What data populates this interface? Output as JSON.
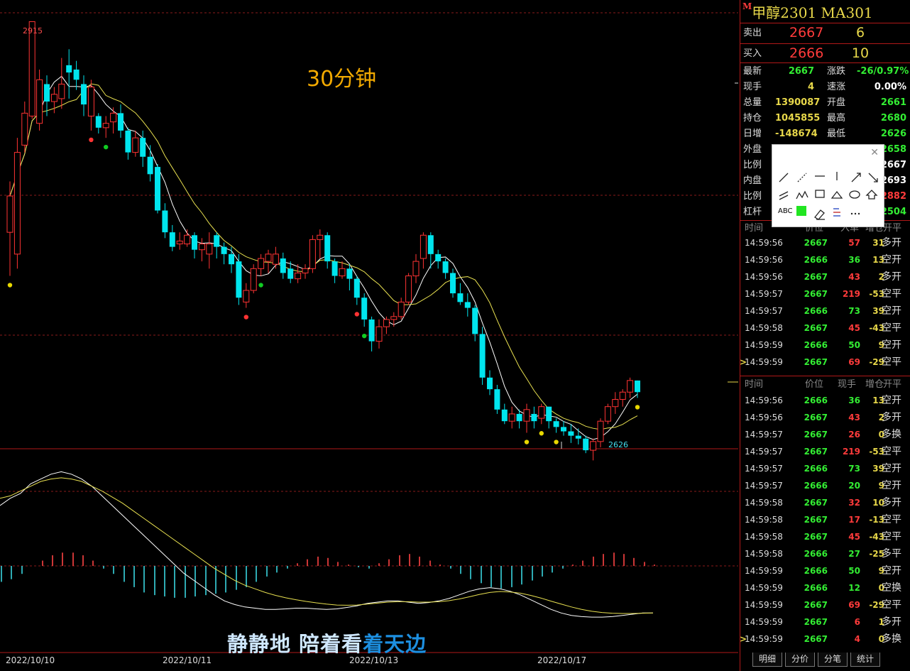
{
  "chart_data": {
    "type": "candlestick",
    "period_label": "30分钟",
    "max_label": "2915",
    "min_label": "2626",
    "ylim": [
      2622,
      2925
    ],
    "dates": [
      "2022/10/10",
      "2022/10/11",
      "2022/10/13",
      "2022/10/17"
    ],
    "candles": [
      [
        2770,
        2795,
        2740,
        2805
      ],
      [
        2755,
        2825,
        2745,
        2835
      ],
      [
        2830,
        2852,
        2825,
        2860
      ],
      [
        2850,
        2915,
        2848,
        2915
      ],
      [
        2845,
        2875,
        2840,
        2882
      ],
      [
        2872,
        2860,
        2850,
        2878
      ],
      [
        2860,
        2865,
        2852,
        2870
      ],
      [
        2862,
        2872,
        2855,
        2890
      ],
      [
        2885,
        2880,
        2862,
        2896
      ],
      [
        2882,
        2875,
        2868,
        2888
      ],
      [
        2872,
        2858,
        2850,
        2878
      ],
      [
        2850,
        2870,
        2840,
        2875
      ],
      [
        2850,
        2842,
        2838,
        2852
      ],
      [
        2842,
        2845,
        2835,
        2850
      ],
      [
        2846,
        2852,
        2838,
        2856
      ],
      [
        2852,
        2840,
        2835,
        2858
      ],
      [
        2840,
        2825,
        2820,
        2842
      ],
      [
        2825,
        2835,
        2822,
        2840
      ],
      [
        2835,
        2822,
        2815,
        2840
      ],
      [
        2822,
        2810,
        2805,
        2830
      ],
      [
        2815,
        2785,
        2783,
        2817
      ],
      [
        2785,
        2770,
        2766,
        2790
      ],
      [
        2770,
        2760,
        2757,
        2775
      ],
      [
        2762,
        2764,
        2758,
        2770
      ],
      [
        2762,
        2768,
        2760,
        2772
      ],
      [
        2768,
        2758,
        2752,
        2770
      ],
      [
        2758,
        2762,
        2750,
        2766
      ],
      [
        2755,
        2762,
        2745,
        2770
      ],
      [
        2768,
        2760,
        2752,
        2770
      ],
      [
        2760,
        2755,
        2748,
        2763
      ],
      [
        2755,
        2748,
        2742,
        2760
      ],
      [
        2750,
        2725,
        2720,
        2755
      ],
      [
        2722,
        2730,
        2718,
        2735
      ],
      [
        2730,
        2745,
        2728,
        2748
      ],
      [
        2745,
        2752,
        2740,
        2755
      ],
      [
        2750,
        2755,
        2742,
        2758
      ],
      [
        2748,
        2755,
        2745,
        2760
      ],
      [
        2752,
        2742,
        2738,
        2756
      ],
      [
        2745,
        2738,
        2735,
        2750
      ],
      [
        2738,
        2742,
        2735,
        2748
      ],
      [
        2742,
        2745,
        2738,
        2748
      ],
      [
        2745,
        2765,
        2742,
        2768
      ],
      [
        2765,
        2768,
        2752,
        2772
      ],
      [
        2768,
        2750,
        2745,
        2770
      ],
      [
        2750,
        2740,
        2735,
        2752
      ],
      [
        2740,
        2745,
        2738,
        2750
      ],
      [
        2745,
        2738,
        2730,
        2748
      ],
      [
        2738,
        2725,
        2720,
        2740
      ],
      [
        2725,
        2710,
        2705,
        2728
      ],
      [
        2710,
        2695,
        2688,
        2712
      ],
      [
        2695,
        2705,
        2690,
        2710
      ],
      [
        2705,
        2710,
        2700,
        2712
      ],
      [
        2710,
        2712,
        2705,
        2715
      ],
      [
        2712,
        2722,
        2710,
        2725
      ],
      [
        2722,
        2740,
        2720,
        2742
      ],
      [
        2740,
        2750,
        2735,
        2755
      ],
      [
        2752,
        2768,
        2745,
        2770
      ],
      [
        2768,
        2755,
        2745,
        2770
      ],
      [
        2755,
        2750,
        2745,
        2758
      ],
      [
        2750,
        2742,
        2738,
        2752
      ],
      [
        2742,
        2728,
        2725,
        2745
      ],
      [
        2728,
        2722,
        2720,
        2735
      ],
      [
        2722,
        2718,
        2712,
        2728
      ],
      [
        2718,
        2700,
        2695,
        2720
      ],
      [
        2700,
        2670,
        2665,
        2705
      ],
      [
        2670,
        2662,
        2658,
        2675
      ],
      [
        2662,
        2648,
        2645,
        2665
      ],
      [
        2648,
        2640,
        2638,
        2652
      ],
      [
        2640,
        2645,
        2635,
        2650
      ],
      [
        2645,
        2640,
        2635,
        2648
      ],
      [
        2640,
        2648,
        2632,
        2652
      ],
      [
        2645,
        2640,
        2635,
        2650
      ],
      [
        2642,
        2650,
        2638,
        2652
      ],
      [
        2650,
        2640,
        2635,
        2650
      ],
      [
        2640,
        2636,
        2632,
        2642
      ],
      [
        2636,
        2633,
        2630,
        2640
      ],
      [
        2633,
        2630,
        2625,
        2638
      ],
      [
        2630,
        2628,
        2624,
        2635
      ],
      [
        2628,
        2620,
        2618,
        2630
      ],
      [
        2620,
        2626,
        2613,
        2628
      ],
      [
        2626,
        2640,
        2622,
        2642
      ],
      [
        2640,
        2650,
        2638,
        2652
      ],
      [
        2650,
        2655,
        2645,
        2660
      ],
      [
        2655,
        2660,
        2650,
        2662
      ],
      [
        2660,
        2668,
        2656,
        2670
      ],
      [
        2668,
        2660,
        2656,
        2668
      ]
    ],
    "macd_dif": [
      2.5,
      2.8,
      3.0,
      3.4,
      3.6,
      3.8,
      3.9,
      3.8,
      3.6,
      3.3,
      2.9,
      2.5,
      2.1,
      1.7,
      1.3,
      0.9,
      0.5,
      0.1,
      -0.3,
      -0.6,
      -0.9,
      -1.2,
      -1.45,
      -1.6,
      -1.7,
      -1.75,
      -1.8,
      -1.8,
      -1.78,
      -1.75,
      -1.75,
      -1.78,
      -1.8,
      -1.78,
      -1.72,
      -1.65,
      -1.55,
      -1.5,
      -1.45,
      -1.45,
      -1.5,
      -1.55,
      -1.52,
      -1.45,
      -1.35,
      -1.2,
      -1.05,
      -0.95,
      -0.9,
      -0.95,
      -1.05,
      -1.2,
      -1.4,
      -1.6,
      -1.8,
      -1.95,
      -2.05,
      -2.1,
      -2.12,
      -2.12,
      -2.1,
      -2.05,
      -2.0,
      -1.95,
      -1.95
    ],
    "macd_dea": [
      2.8,
      2.9,
      3.1,
      3.3,
      3.5,
      3.6,
      3.65,
      3.6,
      3.5,
      3.3,
      3.1,
      2.85,
      2.6,
      2.3,
      2.0,
      1.7,
      1.4,
      1.1,
      0.8,
      0.5,
      0.2,
      -0.1,
      -0.35,
      -0.6,
      -0.8,
      -0.95,
      -1.1,
      -1.22,
      -1.32,
      -1.4,
      -1.47,
      -1.53,
      -1.58,
      -1.62,
      -1.63,
      -1.62,
      -1.58,
      -1.54,
      -1.5,
      -1.48,
      -1.48,
      -1.5,
      -1.5,
      -1.48,
      -1.44,
      -1.37,
      -1.28,
      -1.18,
      -1.1,
      -1.06,
      -1.08,
      -1.13,
      -1.22,
      -1.33,
      -1.46,
      -1.58,
      -1.7,
      -1.8,
      -1.88,
      -1.93,
      -1.96,
      -1.97,
      -1.97,
      -1.96,
      -1.95
    ],
    "macd_bar": [
      -0.6,
      -0.5,
      -0.3,
      0.0,
      0.2,
      0.4,
      0.5,
      0.5,
      0.4,
      0.2,
      -0.1,
      -0.3,
      -0.6,
      -0.8,
      -1.0,
      -1.1,
      -1.15,
      -1.2,
      -1.2,
      -1.15,
      -1.1,
      -1.05,
      -1.0,
      -0.9,
      -0.8,
      -0.6,
      -0.4,
      -0.25,
      -0.1,
      0.1,
      0.25,
      0.35,
      0.3,
      0.15,
      0.05,
      -0.05,
      -0.1,
      0.1,
      0.25,
      0.4,
      0.45,
      0.35,
      0.2,
      0.05,
      -0.1,
      -0.3,
      -0.5,
      -0.65,
      -0.8,
      -0.85,
      -0.8,
      -0.7,
      -0.55,
      -0.4,
      -0.25,
      -0.1,
      0.05,
      0.2,
      0.35,
      0.45,
      0.5,
      0.45,
      0.3,
      0.15,
      0.05
    ],
    "markers": [
      {
        "i": 0,
        "pos": "low",
        "color": "#e8d800"
      },
      {
        "i": 11,
        "pos": "low",
        "color": "#ff3333"
      },
      {
        "i": 13,
        "pos": "low",
        "color": "#11cc22"
      },
      {
        "i": 32,
        "pos": "low",
        "color": "#ff3333"
      },
      {
        "i": 34,
        "pos": "low",
        "color": "#11cc22"
      },
      {
        "i": 47,
        "pos": "low",
        "color": "#ff3333"
      },
      {
        "i": 48,
        "pos": "low",
        "color": "#11cc22"
      },
      {
        "i": 70,
        "pos": "low",
        "color": "#e8d800"
      },
      {
        "i": 72,
        "pos": "low",
        "color": "#e8d800"
      },
      {
        "i": 74,
        "pos": "low",
        "color": "#e8d800"
      },
      {
        "i": 85,
        "pos": "low",
        "color": "#e8d800"
      }
    ]
  },
  "caption": {
    "part1": "静静地 陪着看",
    "part2": "着天边"
  },
  "quote": {
    "title": "甲醇2301 MA301",
    "badge": "M",
    "sell_label": "卖出",
    "sell_price": "2667",
    "sell_vol": "6",
    "buy_label": "买入",
    "buy_price": "2666",
    "buy_vol": "10"
  },
  "stats": [
    {
      "l1": "最新",
      "v1": "2667",
      "c1": "#33ee33",
      "l2": "涨跌",
      "v2": "-26/0.97%",
      "c2": "#33ee33"
    },
    {
      "l1": "现手",
      "v1": "4",
      "c1": "#e8d84a",
      "l2": "速涨",
      "v2": "0.00%",
      "c2": "#ffffff"
    },
    {
      "l1": "总量",
      "v1": "1390087",
      "c1": "#e8d84a",
      "l2": "开盘",
      "v2": "2661",
      "c2": "#33ee33"
    },
    {
      "l1": "持仓",
      "v1": "1045855",
      "c1": "#e8d84a",
      "l2": "最高",
      "v2": "2680",
      "c2": "#33ee33"
    },
    {
      "l1": "日增",
      "v1": "-148674",
      "c1": "#e8d84a",
      "l2": "最低",
      "v2": "2626",
      "c2": "#33ee33"
    },
    {
      "l1": "外盘",
      "v1": "",
      "c1": "#ff3b3b",
      "l2": "",
      "v2": "2658",
      "c2": "#33ee33"
    },
    {
      "l1": "比例",
      "v1": "",
      "c1": "#ff3b3b",
      "l2": "",
      "v2": "2667",
      "c2": "#ffffff"
    },
    {
      "l1": "内盘",
      "v1": "",
      "c1": "#33ee33",
      "l2": "",
      "v2": "2693",
      "c2": "#ffffff"
    },
    {
      "l1": "比例",
      "v1": "",
      "c1": "#33ee33",
      "l2": "",
      "v2": "2882",
      "c2": "#ff3b3b"
    },
    {
      "l1": "杠杆",
      "v1": "",
      "c1": "#ffffff",
      "l2": "",
      "v2": "2504",
      "c2": "#33ee33"
    }
  ],
  "table1_header": {
    "time": "时间",
    "price": "价位",
    "vol": "入单",
    "oi": "增仓",
    "type": "开平"
  },
  "table2_header": {
    "time": "时间",
    "price": "价位",
    "vol": "现手",
    "oi": "增仓",
    "type": "开平"
  },
  "table1": [
    {
      "time": "14:59:56",
      "price": "2667",
      "vol": "57",
      "oi": "31",
      "type": "多开",
      "pc": "#33ee33",
      "vc": "#ff3b3b",
      "oc": "#e8d84a",
      "tc": "#ddd",
      "mark": ""
    },
    {
      "time": "14:59:56",
      "price": "2666",
      "vol": "36",
      "oi": "13",
      "type": "空开",
      "pc": "#33ee33",
      "vc": "#33ee33",
      "oc": "#e8d84a",
      "tc": "#ddd",
      "mark": ""
    },
    {
      "time": "14:59:56",
      "price": "2667",
      "vol": "43",
      "oi": "2",
      "type": "多开",
      "pc": "#33ee33",
      "vc": "#ff3b3b",
      "oc": "#e8d84a",
      "tc": "#ddd",
      "mark": ""
    },
    {
      "time": "14:59:57",
      "price": "2667",
      "vol": "219",
      "oi": "-53",
      "type": "空平",
      "pc": "#33ee33",
      "vc": "#ff3b3b",
      "oc": "#e8d84a",
      "tc": "#ddd",
      "mark": ""
    },
    {
      "time": "14:59:57",
      "price": "2666",
      "vol": "73",
      "oi": "39",
      "type": "空开",
      "pc": "#33ee33",
      "vc": "#33ee33",
      "oc": "#e8d84a",
      "tc": "#ddd",
      "mark": ""
    },
    {
      "time": "14:59:58",
      "price": "2667",
      "vol": "45",
      "oi": "-43",
      "type": "空平",
      "pc": "#33ee33",
      "vc": "#ff3b3b",
      "oc": "#e8d84a",
      "tc": "#ddd",
      "mark": ""
    },
    {
      "time": "14:59:59",
      "price": "2666",
      "vol": "50",
      "oi": "9",
      "type": "空开",
      "pc": "#33ee33",
      "vc": "#33ee33",
      "oc": "#e8d84a",
      "tc": "#ddd",
      "mark": ""
    },
    {
      "time": "14:59:59",
      "price": "2667",
      "vol": "69",
      "oi": "-29",
      "type": "空平",
      "pc": "#33ee33",
      "vc": "#ff3b3b",
      "oc": "#e8d84a",
      "tc": "#ddd",
      "mark": ">"
    }
  ],
  "table2": [
    {
      "time": "14:59:56",
      "price": "2666",
      "vol": "36",
      "oi": "13",
      "type": "空开",
      "pc": "#33ee33",
      "vc": "#33ee33",
      "oc": "#e8d84a",
      "mark": ""
    },
    {
      "time": "14:59:56",
      "price": "2667",
      "vol": "43",
      "oi": "2",
      "type": "多开",
      "pc": "#33ee33",
      "vc": "#ff3b3b",
      "oc": "#e8d84a",
      "mark": ""
    },
    {
      "time": "14:59:57",
      "price": "2667",
      "vol": "26",
      "oi": "0",
      "type": "多换",
      "pc": "#33ee33",
      "vc": "#ff3b3b",
      "oc": "#e8d84a",
      "mark": ""
    },
    {
      "time": "14:59:57",
      "price": "2667",
      "vol": "219",
      "oi": "-53",
      "type": "空平",
      "pc": "#33ee33",
      "vc": "#ff3b3b",
      "oc": "#e8d84a",
      "mark": ""
    },
    {
      "time": "14:59:57",
      "price": "2666",
      "vol": "73",
      "oi": "39",
      "type": "空开",
      "pc": "#33ee33",
      "vc": "#33ee33",
      "oc": "#e8d84a",
      "mark": ""
    },
    {
      "time": "14:59:57",
      "price": "2666",
      "vol": "20",
      "oi": "9",
      "type": "空开",
      "pc": "#33ee33",
      "vc": "#33ee33",
      "oc": "#e8d84a",
      "mark": ""
    },
    {
      "time": "14:59:58",
      "price": "2667",
      "vol": "32",
      "oi": "10",
      "type": "多开",
      "pc": "#33ee33",
      "vc": "#ff3b3b",
      "oc": "#e8d84a",
      "mark": ""
    },
    {
      "time": "14:59:58",
      "price": "2667",
      "vol": "17",
      "oi": "-13",
      "type": "空平",
      "pc": "#33ee33",
      "vc": "#ff3b3b",
      "oc": "#e8d84a",
      "mark": ""
    },
    {
      "time": "14:59:58",
      "price": "2667",
      "vol": "45",
      "oi": "-43",
      "type": "空平",
      "pc": "#33ee33",
      "vc": "#ff3b3b",
      "oc": "#e8d84a",
      "mark": ""
    },
    {
      "time": "14:59:58",
      "price": "2666",
      "vol": "27",
      "oi": "-25",
      "type": "多平",
      "pc": "#33ee33",
      "vc": "#33ee33",
      "oc": "#e8d84a",
      "mark": ""
    },
    {
      "time": "14:59:59",
      "price": "2666",
      "vol": "50",
      "oi": "9",
      "type": "空开",
      "pc": "#33ee33",
      "vc": "#33ee33",
      "oc": "#e8d84a",
      "mark": ""
    },
    {
      "time": "14:59:59",
      "price": "2666",
      "vol": "12",
      "oi": "0",
      "type": "空换",
      "pc": "#33ee33",
      "vc": "#33ee33",
      "oc": "#e8d84a",
      "mark": ""
    },
    {
      "time": "14:59:59",
      "price": "2667",
      "vol": "69",
      "oi": "-29",
      "type": "空平",
      "pc": "#33ee33",
      "vc": "#ff3b3b",
      "oc": "#e8d84a",
      "mark": ""
    },
    {
      "time": "14:59:59",
      "price": "2667",
      "vol": "6",
      "oi": "1",
      "type": "多开",
      "pc": "#33ee33",
      "vc": "#ff3b3b",
      "oc": "#e8d84a",
      "mark": ""
    },
    {
      "time": "14:59:59",
      "price": "2667",
      "vol": "4",
      "oi": "0",
      "type": "多换",
      "pc": "#33ee33",
      "vc": "#ff3b3b",
      "oc": "#e8d84a",
      "mark": ">"
    }
  ],
  "tabs": [
    "明细",
    "分价",
    "分笔",
    "统计"
  ],
  "colors": {
    "up": "#ff3333",
    "down": "#00e5ee",
    "ma_fast": "#ffffff",
    "ma_slow": "#e8e050",
    "grid": "#8a1a1a"
  },
  "draw_toolbar_icons": [
    "line-tool-icon",
    "ray-tool-icon",
    "hline-tool-icon",
    "vline-tool-icon",
    "arrow-up-tool-icon",
    "arrow-down-tool-icon",
    "parallel-tool-icon",
    "wave-tool-icon",
    "rect-tool-icon",
    "triangle-tool-icon",
    "ellipse-tool-icon",
    "up-arrow-shape-icon",
    "text-tool-icon",
    "color-picker-icon",
    "eraser-icon",
    "style-tool-icon",
    "more-tools-icon"
  ],
  "draw_toolbar_text": "ABC"
}
